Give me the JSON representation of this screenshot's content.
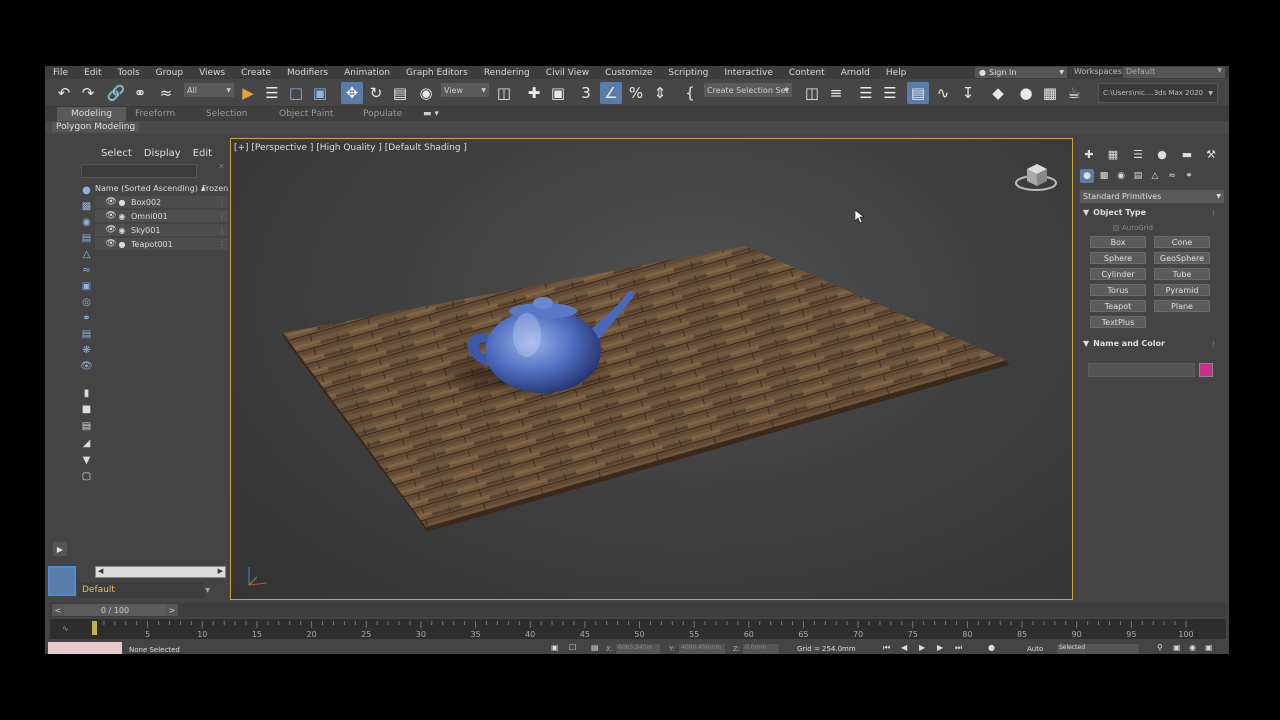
{
  "menu": [
    "File",
    "Edit",
    "Tools",
    "Group",
    "Views",
    "Create",
    "Modifiers",
    "Animation",
    "Graph Editors",
    "Rendering",
    "Civil View",
    "Customize",
    "Scripting",
    "Interactive",
    "Content",
    "Arnold",
    "Help"
  ],
  "signin": "Sign In",
  "workspace": {
    "label": "Workspaces:",
    "value": "Default"
  },
  "toolbar": {
    "filter": "All",
    "ref_coord": "View",
    "selection_set": "Create Selection Set",
    "path": "C:\\Users\\nic....3ds Max 2020",
    "icons": [
      "undo-icon",
      "redo-icon",
      "link-icon",
      "unlink-icon",
      "bind-spacewarp-icon",
      "select-object-icon",
      "select-by-name-icon",
      "rect-region-icon",
      "window-crossing-icon",
      "select-move-icon",
      "select-rotate-icon",
      "select-scale-icon",
      "placement-icon",
      "snap-icon",
      "angle-snap-icon",
      "percent-snap-icon",
      "spinner-snap-icon",
      "edit-named-sets-icon",
      "mirror-icon",
      "align-icon",
      "scene-explorer-icon",
      "layer-explorer-icon",
      "ribbon-toggle-icon",
      "curve-editor-icon",
      "schematic-view-icon",
      "material-editor-icon",
      "render-setup-icon",
      "render-frame-icon",
      "render-icon"
    ]
  },
  "ribbon": {
    "tabs": [
      "Modeling",
      "Freeform",
      "Selection",
      "Object Paint",
      "Populate"
    ],
    "panel": "Polygon Modeling"
  },
  "explorer": {
    "menu": [
      "Select",
      "Display",
      "Edit"
    ],
    "col_name": "Name (Sorted Ascending)",
    "col_frozen": "Frozen",
    "rows": [
      {
        "name": "Box002",
        "type": "geometry"
      },
      {
        "name": "Omni001",
        "type": "light"
      },
      {
        "name": "Sky001",
        "type": "light"
      },
      {
        "name": "Teapot001",
        "type": "geometry"
      }
    ],
    "layer": "Default"
  },
  "viewport": {
    "label": "[+] [Perspective ] [High Quality ] [Default Shading ]"
  },
  "command_panel": {
    "category": "Standard Primitives",
    "object_type_title": "Object Type",
    "autogrid": "AutoGrid",
    "primitives": [
      "Box",
      "Cone",
      "Sphere",
      "GeoSphere",
      "Cylinder",
      "Tube",
      "Torus",
      "Pyramid",
      "Teapot",
      "Plane",
      "TextPlus"
    ],
    "name_color_title": "Name and Color",
    "swatch_color": "#c8308c"
  },
  "timeline": {
    "slider": "0 / 100",
    "ticks": [
      5,
      10,
      15,
      20,
      25,
      30,
      35,
      40,
      45,
      50,
      55,
      60,
      65,
      70,
      75,
      80,
      85,
      90,
      95,
      100
    ]
  },
  "status": {
    "selection": "None Selected",
    "x_label": "X:",
    "x_value": "6065.245m",
    "y_label": "Y:",
    "y_value": "4000.456mm",
    "z_label": "Z:",
    "z_value": "0.0mm",
    "grid": "Grid = 254.0mm",
    "auto": "Auto",
    "key_mode": "Selected"
  }
}
